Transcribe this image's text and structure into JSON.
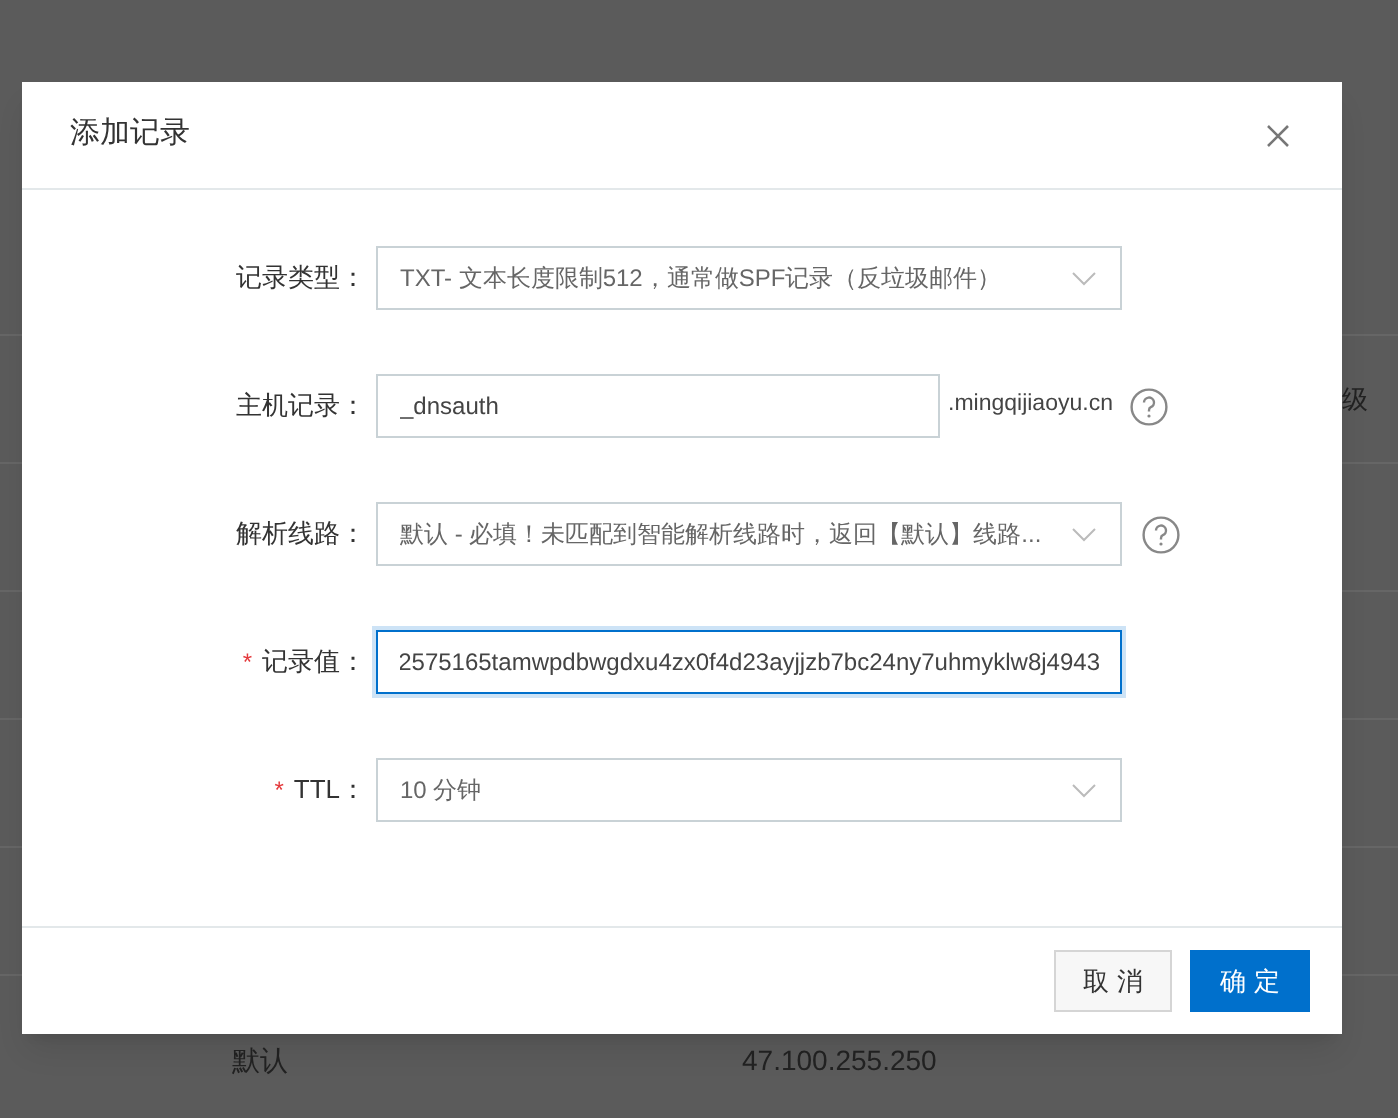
{
  "background": {
    "header_cell": "级",
    "rows": [
      {
        "line": "默认",
        "value": "47.100.255.250"
      }
    ]
  },
  "dialog": {
    "title": "添加记录",
    "fields": [
      {
        "kind": "select",
        "label": "记录类型：",
        "value": "TXT- 文本长度限制512，通常做SPF记录（反垃圾邮件）"
      },
      {
        "kind": "input",
        "label": "主机记录：",
        "value": "_dnsauth",
        "suffix": ".mingqijiaoyu.cn",
        "help": true,
        "focused": false
      },
      {
        "kind": "select",
        "label": "解析线路：",
        "value": "默认 - 必填！未匹配到智能解析线路时，返回【默认】线路...",
        "help": true
      },
      {
        "kind": "input",
        "label": "记录值：",
        "required_mark": "*",
        "value": "2575165tamwpdbwgdxu4zx0f4d23ayjjzb7bc24ny7uhmyklw8j4943",
        "focused": true
      },
      {
        "kind": "select",
        "label": "TTL：",
        "required_mark": "*",
        "value": "10 分钟"
      }
    ],
    "buttons": [
      {
        "label": "取 消",
        "kind": "secondary"
      },
      {
        "label": "确 定",
        "kind": "primary"
      }
    ]
  }
}
